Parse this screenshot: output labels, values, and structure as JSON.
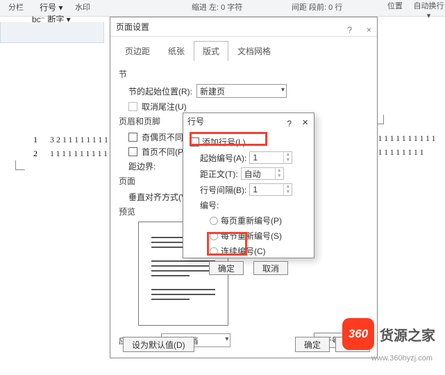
{
  "ribbon": {
    "columns": "分栏",
    "lineNums": "行号 ▾",
    "hyphen": "bc⁻ 断字 ▾",
    "watermark": "水印",
    "indentLeft": "缩进 左: 0 字符",
    "spacingBefore": "间距 段前: 0 行",
    "position": "位置",
    "wrap": "自动换行 ▾"
  },
  "doc": {
    "ln1": "1",
    "ln2": "2",
    "t1": "3211111111",
    "t2": "1111111111",
    "t3": "11111111111",
    "right": "111111111"
  },
  "dialog": {
    "title": "页面设置",
    "help": "?",
    "close": "×",
    "tabs": {
      "margin": "页边距",
      "paper": "纸张",
      "layout": "版式",
      "grid": "文档网格"
    },
    "section": "节",
    "sectionStartLabel": "节的起始位置(R):",
    "sectionStartValue": "新建页",
    "suppressEndnotes": "取消尾注(U)",
    "hf": "页眉和页脚",
    "oddEven": "奇偶页不同(O)",
    "firstPage": "首页不同(P)",
    "fromEdge": "距边界:",
    "page": "页面",
    "valign": "垂直对齐方式(V):",
    "preview": "预览",
    "applyTo": "应用于(Y):",
    "applyToValue": "整篇文档",
    "lineNumBtn": "行号(N)…",
    "setDefault": "设为默认值(D)",
    "ok": "确定",
    "cancel": "取消"
  },
  "dialog2": {
    "title": "行号",
    "addLineNum": "添加行号(L)",
    "startAt": "起始编号(A):",
    "startAtVal": "1",
    "fromText": "距正文(T):",
    "fromTextVal": "自动",
    "countBy": "行号间隔(B):",
    "countByVal": "1",
    "numbering": "编号:",
    "restartPage": "每页重新编号(P)",
    "restartSection": "每节重新编号(S)",
    "continuous": "连续编号(C)",
    "ok": "确定",
    "cancel": "取消"
  },
  "brand": {
    "badge": "360",
    "name": "货源之家",
    "url": "www.360hyzj.com"
  }
}
